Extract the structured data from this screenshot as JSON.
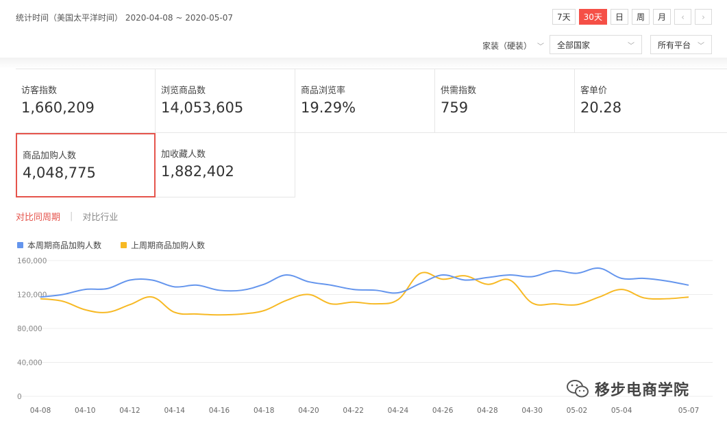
{
  "header": {
    "stat_time": "统计时间（美国太平洋时间） 2020-04-08 ~ 2020-05-07",
    "buttons": [
      {
        "label": "7天",
        "active": false
      },
      {
        "label": "30天",
        "active": true
      },
      {
        "label": "日",
        "active": false
      },
      {
        "label": "周",
        "active": false
      },
      {
        "label": "月",
        "active": false
      }
    ],
    "prev_label": "‹",
    "next_label": "›"
  },
  "filters": {
    "category": "家装（硬装）",
    "country": "全部国家",
    "platform": "所有平台"
  },
  "metrics": [
    {
      "label": "访客指数",
      "value": "1,660,209"
    },
    {
      "label": "浏览商品数",
      "value": "14,053,605"
    },
    {
      "label": "商品浏览率",
      "value": "19.29%"
    },
    {
      "label": "供需指数",
      "value": "759"
    },
    {
      "label": "客单价",
      "value": "20.28"
    },
    {
      "label": "商品加购人数",
      "value": "4,048,775",
      "selected": true
    },
    {
      "label": "加收藏人数",
      "value": "1,882,402"
    }
  ],
  "compare_tabs": {
    "same_period": "对比同周期",
    "separator": "|",
    "industry": "对比行业"
  },
  "watermark": "移步电商学院",
  "chart_data": {
    "type": "line",
    "x": [
      "04-08",
      "04-09",
      "04-10",
      "04-11",
      "04-12",
      "04-13",
      "04-14",
      "04-15",
      "04-16",
      "04-17",
      "04-18",
      "04-19",
      "04-20",
      "04-21",
      "04-22",
      "04-23",
      "04-24",
      "04-25",
      "04-26",
      "04-27",
      "04-28",
      "04-29",
      "04-30",
      "05-01",
      "05-02",
      "05-03",
      "05-04",
      "05-05",
      "05-06",
      "05-07"
    ],
    "x_tick_labels": [
      "04-08",
      "04-10",
      "04-12",
      "04-14",
      "04-16",
      "04-18",
      "04-20",
      "04-22",
      "04-24",
      "04-26",
      "04-28",
      "04-30",
      "05-02",
      "05-04",
      "05-07"
    ],
    "y_tick_labels": [
      "160,000",
      "120,000",
      "80,000",
      "40,000",
      "0"
    ],
    "ylim": [
      0,
      160000
    ],
    "grid": true,
    "legend_position": "top-left",
    "series": [
      {
        "name": "本周期商品加购人数",
        "color": "#6495ed",
        "values": [
          117000,
          120000,
          126000,
          127000,
          137000,
          137000,
          129000,
          131000,
          125000,
          125000,
          132000,
          143000,
          135000,
          131000,
          126000,
          125000,
          122000,
          133000,
          143000,
          137000,
          140000,
          143000,
          141000,
          148000,
          145000,
          151000,
          139000,
          139000,
          136000,
          131000
        ]
      },
      {
        "name": "上周期商品加购人数",
        "color": "#f7b924",
        "values": [
          115000,
          112000,
          102000,
          99000,
          108000,
          117000,
          99000,
          97000,
          96000,
          97000,
          101000,
          113000,
          120000,
          109000,
          111000,
          109000,
          114000,
          145000,
          138000,
          142000,
          132000,
          137000,
          110000,
          109000,
          108000,
          117000,
          126000,
          116000,
          115000,
          117000
        ]
      }
    ]
  }
}
